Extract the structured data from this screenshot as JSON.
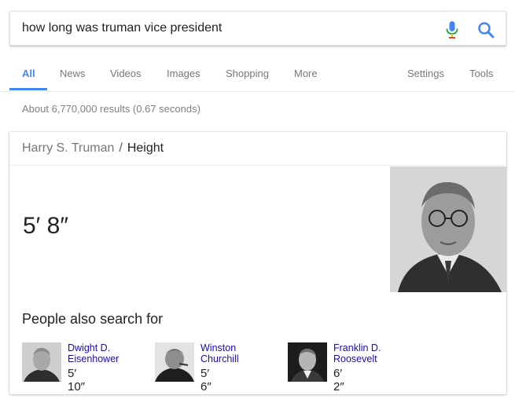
{
  "search": {
    "query": "how long was truman vice president"
  },
  "tabs": [
    {
      "label": "All"
    },
    {
      "label": "News"
    },
    {
      "label": "Videos"
    },
    {
      "label": "Images"
    },
    {
      "label": "Shopping"
    },
    {
      "label": "More"
    },
    {
      "label": "Settings"
    },
    {
      "label": "Tools"
    }
  ],
  "stats": "About 6,770,000 results (0.67 seconds)",
  "card": {
    "entity": "Harry S. Truman",
    "separator": "/",
    "attribute": "Height",
    "answer": "5′ 8″",
    "pasf_title": "People also search for",
    "people": [
      {
        "name_line1": "Dwight D.",
        "name_line2": "Eisenhower",
        "height": "5′ 10″"
      },
      {
        "name_line1": "Winston",
        "name_line2": "Churchill",
        "height": "5′ 6″"
      },
      {
        "name_line1": "Franklin D.",
        "name_line2": "Roosevelt",
        "height": "6′ 2″"
      }
    ]
  },
  "colors": {
    "accent": "#4285f4",
    "link": "#1a0dab",
    "muted": "#777777"
  }
}
